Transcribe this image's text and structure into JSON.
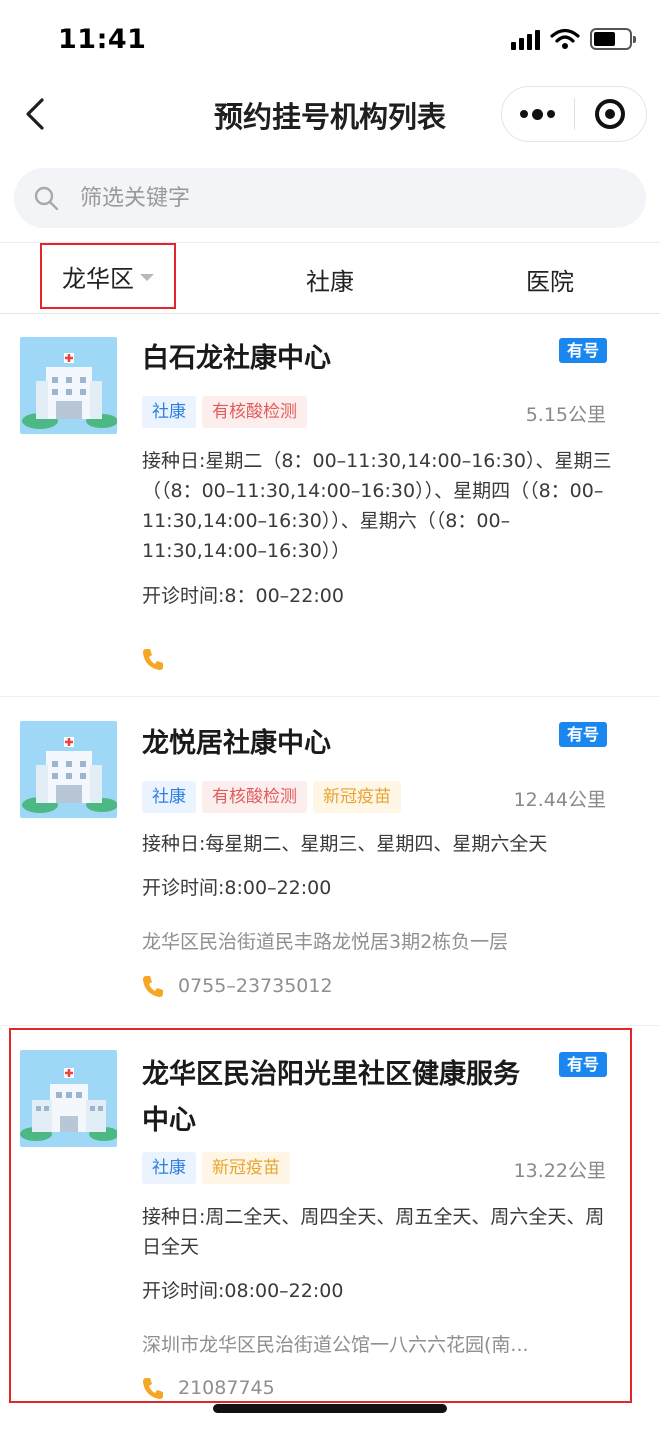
{
  "status_bar": {
    "time": "11:41"
  },
  "nav": {
    "title": "预约挂号机构列表"
  },
  "search": {
    "placeholder": "筛选关键字"
  },
  "filters": {
    "district": "龙华区",
    "community": "社康",
    "hospital": "医院"
  },
  "cards": [
    {
      "name": "白石龙社康中心",
      "badge": "有号",
      "tags": [
        "社康",
        "有核酸检测"
      ],
      "distance": "5.15公里",
      "schedule": "接种日:星期二（8：00–11:30,14:00–16:30）、星期三（（8：00–11:30,14:00–16:30））、星期四（（8：00–11:30,14:00–16:30））、星期六（（8：00–11:30,14:00–16:30））",
      "hours": "开诊时间:8：00–22:00",
      "address": "",
      "phone": ""
    },
    {
      "name": "龙悦居社康中心",
      "badge": "有号",
      "tags": [
        "社康",
        "有核酸检测",
        "新冠疫苗"
      ],
      "distance": "12.44公里",
      "schedule": "接种日:每星期二、星期三、星期四、星期六全天",
      "hours": "开诊时间:8:00–22:00",
      "address": "龙华区民治街道民丰路龙悦居3期2栋负一层",
      "phone": "0755–23735012"
    },
    {
      "name": "龙华区民治阳光里社区健康服务中心",
      "badge": "有号",
      "tags": [
        "社康",
        "新冠疫苗"
      ],
      "distance": "13.22公里",
      "schedule": "接种日:周二全天、周四全天、周五全天、周六全天、周日全天",
      "hours": "开诊时间:08:00–22:00",
      "address": "深圳市龙华区民治街道公馆一八六六花园(南...",
      "phone": "21087745"
    }
  ],
  "colors": {
    "accent_blue": "#1a86f0",
    "highlight_red": "#e3262b",
    "phone_orange": "#f5a623"
  },
  "icons": [
    "back-icon",
    "more-icon",
    "close-target-icon",
    "search-icon",
    "caret-down-icon",
    "hospital-building-icon",
    "phone-icon"
  ]
}
